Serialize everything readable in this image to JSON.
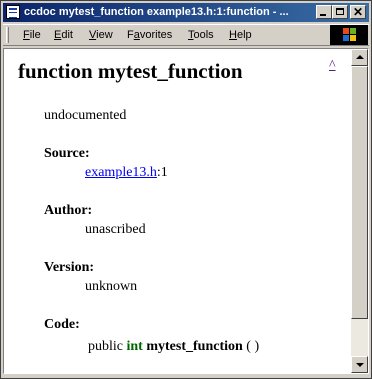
{
  "window": {
    "title": "ccdoc mytest_function example13.h:1:function - ..."
  },
  "menu": {
    "items": [
      {
        "accel": "F",
        "rest": "ile"
      },
      {
        "accel": "E",
        "rest": "dit"
      },
      {
        "accel": "V",
        "rest": "iew"
      },
      {
        "accel": "",
        "pre": "F",
        "accel2": "a",
        "rest": "vorites"
      },
      {
        "accel": "T",
        "rest": "ools"
      },
      {
        "accel": "H",
        "rest": "elp"
      }
    ]
  },
  "doc": {
    "heading": "function mytest_function",
    "up_link": "^",
    "description": "undocumented",
    "source_label": "Source:",
    "source_file": "example13.h",
    "source_line": ":1",
    "author_label": "Author:",
    "author_value": "unascribed",
    "version_label": "Version:",
    "version_value": "unknown",
    "code_label": "Code:",
    "code": {
      "modifier": "public",
      "type": "int",
      "name": "mytest_function",
      "params": "( )"
    }
  },
  "colors": {
    "titlebar_start": "#0a246a",
    "titlebar_end": "#3a6ea5",
    "keyword": "#006400",
    "link": "#0000ee",
    "visited_link": "#551a8b"
  }
}
